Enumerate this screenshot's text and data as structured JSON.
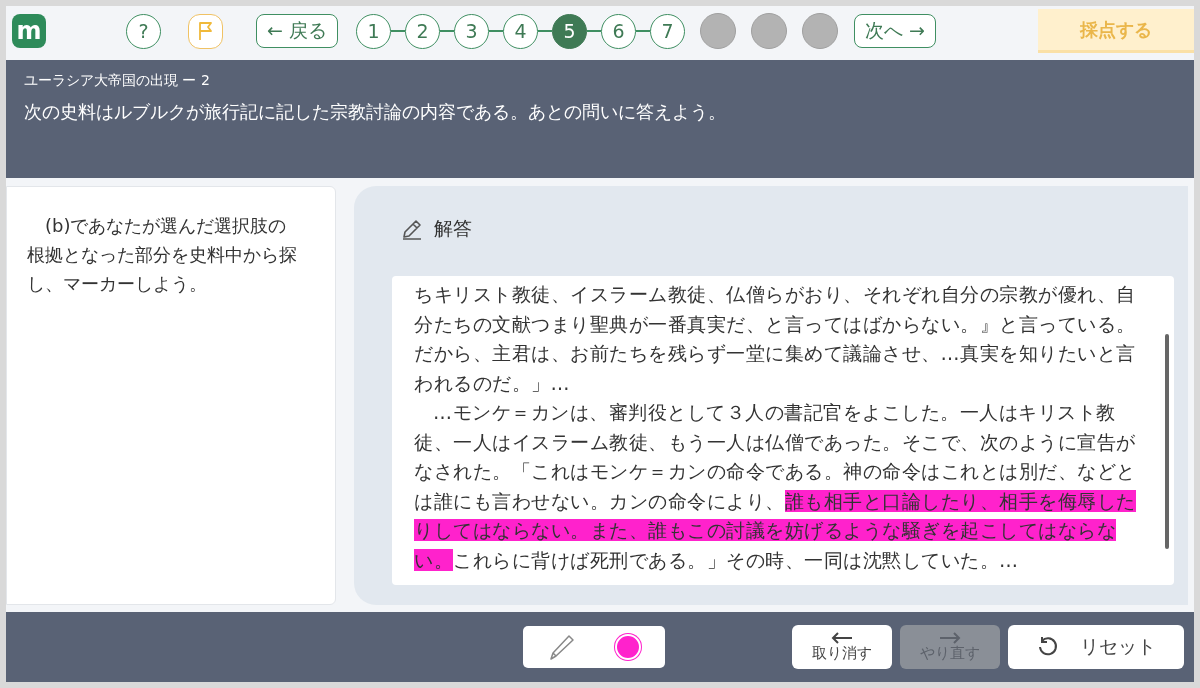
{
  "app": {
    "logo": "m"
  },
  "toolbar": {
    "help": "?",
    "back": "← 戻る",
    "next": "次へ →",
    "grade": "採点する",
    "steps": [
      {
        "kind": "numbered",
        "label": "1",
        "selected": false
      },
      {
        "kind": "numbered",
        "label": "2",
        "selected": false
      },
      {
        "kind": "numbered",
        "label": "3",
        "selected": false
      },
      {
        "kind": "numbered",
        "label": "4",
        "selected": false
      },
      {
        "kind": "numbered",
        "label": "5",
        "selected": true
      },
      {
        "kind": "numbered",
        "label": "6",
        "selected": false
      },
      {
        "kind": "numbered",
        "label": "7",
        "selected": false
      },
      {
        "kind": "blank",
        "selected": false
      },
      {
        "kind": "blank",
        "selected": false
      },
      {
        "kind": "blank",
        "selected": false
      }
    ]
  },
  "header": {
    "title": "ユーラシア大帝国の出現 ー 2",
    "question": "次の史料はルブルクが旅行記に記した宗教討論の内容である。あとの問いに答えよう。"
  },
  "instruction": "(b)であなたが選んだ選択肢の根拠となった部分を史料中から探し、マーカーしよう。",
  "answer": {
    "heading": "解答",
    "paragraphs": [
      {
        "indent": false,
        "segments": [
          {
            "text": "ちキリスト教徒、イスラーム教徒、仏僧らがおり、それぞれ自分の宗教が優れ、自分たちの文献つまり聖典が一番真実だ、と言ってはばからない。』と言っている。だから、主君は、お前たちを残らず一堂に集めて議論させ、…真実を知りたいと言われるのだ。」…",
            "highlighted": false
          }
        ]
      },
      {
        "indent": true,
        "segments": [
          {
            "text": "…モンケ＝カンは、審判役として３人の書記官をよこした。一人はキリスト教徒、一人はイスラーム教徒、もう一人は仏僧であった。そこで、次のように宣告がなされた。「これはモンケ＝カンの命令である。神の命令はこれとは別だ、などとは誰にも言わせない。カンの命令により、",
            "highlighted": false
          },
          {
            "text": "誰も相手と口論したり、相手を侮辱したりしてはならない。また、誰もこの討議を妨げるような騒ぎを起こしてはならない。",
            "highlighted": true
          },
          {
            "text": "これらに背けば死刑である。」その時、一同は沈黙していた。…",
            "highlighted": false
          }
        ]
      }
    ]
  },
  "marker": {
    "color": "#ff22cc"
  },
  "actions": [
    {
      "kind": "undo",
      "label": "取り消す",
      "disabled": false
    },
    {
      "kind": "redo",
      "label": "やり直す",
      "disabled": true
    },
    {
      "kind": "reset",
      "label": "リセット",
      "disabled": false
    }
  ]
}
